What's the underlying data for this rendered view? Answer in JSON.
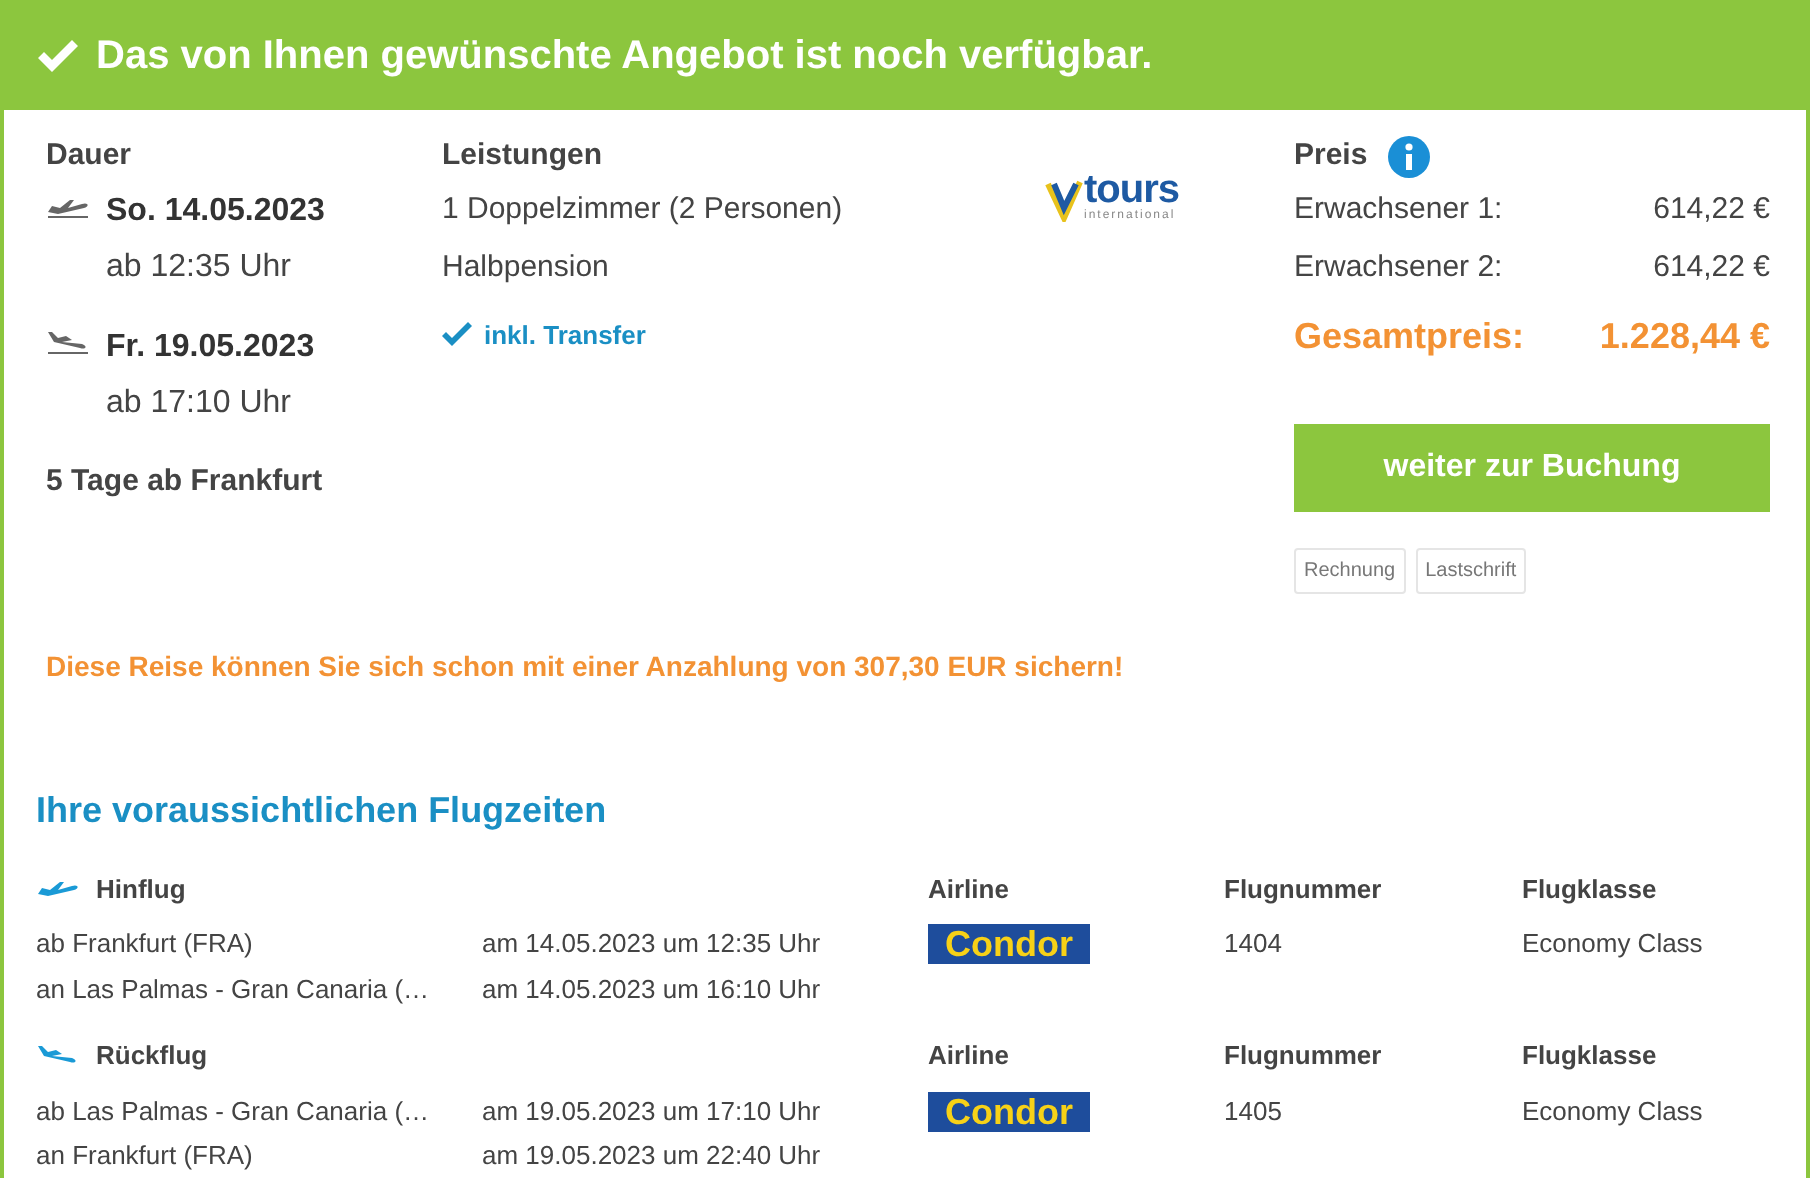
{
  "banner": {
    "text": "Das von Ihnen gewünschte Angebot ist noch verfügbar."
  },
  "dauer": {
    "heading": "Dauer",
    "legs": [
      {
        "kind": "departure",
        "date": "So. 14.05.2023",
        "time": "ab 12:35 Uhr"
      },
      {
        "kind": "arrival",
        "date": "Fr. 19.05.2023",
        "time": "ab 17:10 Uhr"
      }
    ],
    "summary": "5 Tage ab Frankfurt"
  },
  "leistungen": {
    "heading": "Leistungen",
    "items": [
      "1 Doppelzimmer (2 Personen)",
      "Halbpension"
    ],
    "transfer": "inkl. Transfer"
  },
  "operator_logo": {
    "name": "tours",
    "subtitle": "international"
  },
  "preis": {
    "heading": "Preis",
    "rows": [
      {
        "label": "Erwachsener 1:",
        "amount": "614,22 €"
      },
      {
        "label": "Erwachsener 2:",
        "amount": "614,22 €"
      }
    ],
    "total_label": "Gesamtpreis:",
    "total": "1.228,44 €",
    "button": "weiter zur Buchung",
    "payment_methods": [
      "Rechnung",
      "Lastschrift"
    ]
  },
  "deposit_note": "Diese Reise können Sie sich schon mit einer Anzahlung von 307,30 EUR sichern!",
  "flights": {
    "heading": "Ihre voraussichtlichen Flugzeiten",
    "legs": [
      {
        "kind": "outbound",
        "title": "Hinflug",
        "airline_label": "Airline",
        "number_label": "Flugnummer",
        "class_label": "Flugklasse",
        "airline": "Condor",
        "number": "1404",
        "class": "Economy Class",
        "stops": [
          {
            "place": "ab Frankfurt (FRA)",
            "time": "am 14.05.2023 um 12:35 Uhr"
          },
          {
            "place": "an Las Palmas - Gran Canaria (…",
            "time": "am 14.05.2023 um 16:10 Uhr"
          }
        ]
      },
      {
        "kind": "return",
        "title": "Rückflug",
        "airline_label": "Airline",
        "number_label": "Flugnummer",
        "class_label": "Flugklasse",
        "airline": "Condor",
        "number": "1405",
        "class": "Economy Class",
        "stops": [
          {
            "place": "ab Las Palmas - Gran Canaria (…",
            "time": "am 19.05.2023 um 17:10 Uhr"
          },
          {
            "place": "an Frankfurt (FRA)",
            "time": "am 19.05.2023 um 22:40 Uhr"
          }
        ]
      }
    ]
  }
}
